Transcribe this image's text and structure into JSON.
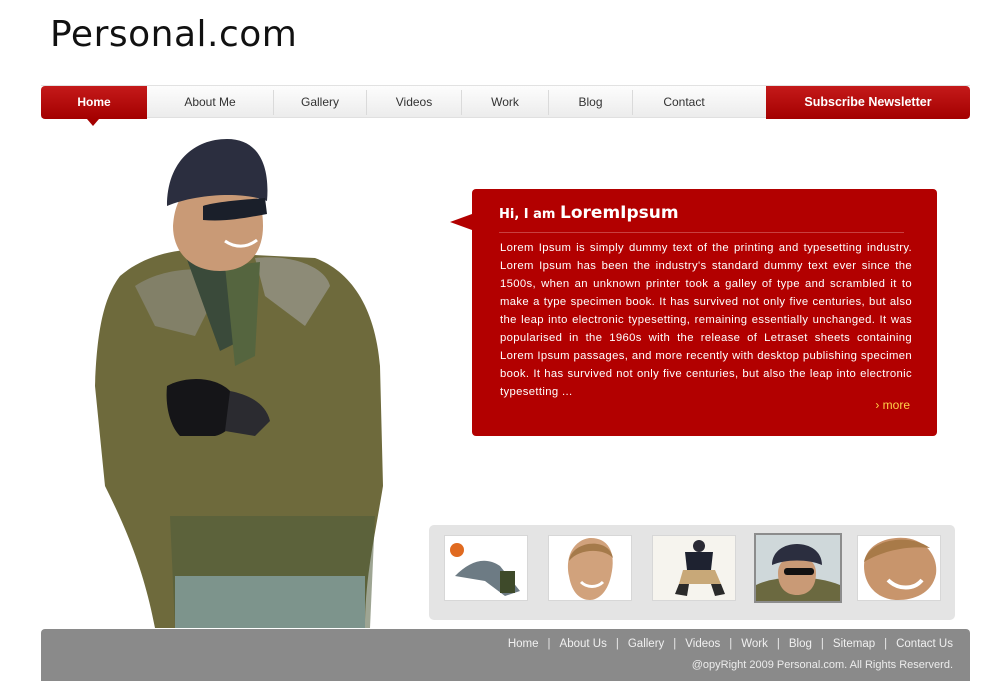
{
  "site": {
    "logo": "Personal.com"
  },
  "nav": {
    "items": [
      {
        "label": "Home"
      },
      {
        "label": "About Me"
      },
      {
        "label": "Gallery"
      },
      {
        "label": "Videos"
      },
      {
        "label": "Work"
      },
      {
        "label": "Blog"
      },
      {
        "label": "Contact"
      }
    ],
    "subscribe": "Subscribe Newsletter"
  },
  "intro": {
    "greeting": "Hi, I am",
    "name": "LoremIpsum",
    "body": "Lorem Ipsum is simply dummy text of the printing and typesetting industry. Lorem Ipsum has been the industry's standard dummy text ever since the 1500s, when an unknown printer took a galley of type and scrambled it to make a type specimen book. It has survived not only five centuries, but also the leap into electronic typesetting, remaining essentially unchanged. It was popularised in the 1960s with the release of Letraset sheets containing Lorem Ipsum passages, and more recently with desktop publishing specimen book. It has survived not only five centuries, but also the leap into electronic typesetting ...",
    "more": "› more"
  },
  "gallery": {
    "selected_index": 3
  },
  "footer": {
    "links": [
      "Home",
      "About Us",
      "Gallery",
      "Videos",
      "Work",
      "Blog",
      "Sitemap",
      "Contact Us"
    ],
    "copyright": "@opyRight 2009 Personal.com. All Rights Reserverd."
  },
  "colors": {
    "accent": "#b20000",
    "footer": "#8a8a8a",
    "more_link": "#ffd24a"
  }
}
